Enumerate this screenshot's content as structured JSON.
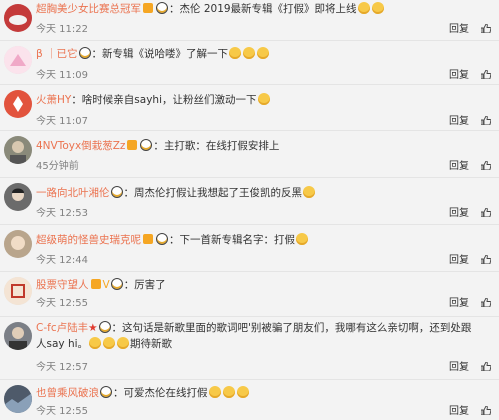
{
  "reply_label": "回复",
  "like_label": "赞",
  "comments": [
    {
      "user": "超胸美少女比赛总冠军",
      "text": "：杰伦 2019最新专辑《打假》即将上线",
      "time": "今天 11:22",
      "avatar_color": "#c43a3a",
      "badge": true,
      "emoji_before": 1,
      "emoji_after": 2
    },
    {
      "user": "β ｜已它",
      "text": "：新专辑《说哈喽》了解一下",
      "time": "今天 11:09",
      "avatar_color": "#f0a9c7",
      "badge": false,
      "emoji_before": 1,
      "emoji_after": 3
    },
    {
      "user": "火萧HY",
      "text": "：啥时候亲自sayhi，让粉丝们激动一下",
      "time": "今天 11:07",
      "avatar_color": "#e2533d",
      "badge": false,
      "emoji_before": 0,
      "emoji_after": 1
    },
    {
      "user": "4NVToyx倒栽葱Zz",
      "text": "：主打歌：在线打假安排上",
      "time": "45分钟前",
      "avatar_color": "#8a8a7a",
      "badge": true,
      "emoji_before": 1,
      "emoji_after": 0
    },
    {
      "user": "一路向北叶湘伦",
      "text": "：周杰伦打假让我想起了王俊凯的反黑",
      "time": "今天 12:53",
      "avatar_color": "#6b6b6b",
      "badge": false,
      "emoji_before": 1,
      "emoji_after": 1
    },
    {
      "user": "超级萌的怪兽史瑞克呢",
      "text": "：下一首新专辑名字：打假",
      "time": "今天 12:44",
      "avatar_color": "#b9a58c",
      "badge": true,
      "emoji_before": 1,
      "emoji_after": 1
    },
    {
      "user": "股票守望人",
      "text": "：厉害了",
      "time": "今天 12:55",
      "avatar_color": "#f4e4d4",
      "badge": true,
      "emoji_before": 1,
      "emoji_after": 0,
      "prefix": "V"
    },
    {
      "user": "C-fc卢陆丰",
      "text": "：这句话是新歌里面的歌词吧'别被骗了朋友们，我哪有这么亲切啊，还到处跟人say hi。",
      "text2": "期待新歌",
      "time": "今天 12:57",
      "avatar_color": "#7b7f86",
      "badge": false,
      "emoji_before": 1,
      "emoji_after": 0,
      "emoji_mid": 3,
      "star": true
    },
    {
      "user": "也曾乘风破浪",
      "text": "：可爱杰伦在线打假",
      "time": "今天 12:55",
      "avatar_color": "#4e5a6a",
      "badge": false,
      "emoji_before": 1,
      "emoji_after": 3
    }
  ]
}
